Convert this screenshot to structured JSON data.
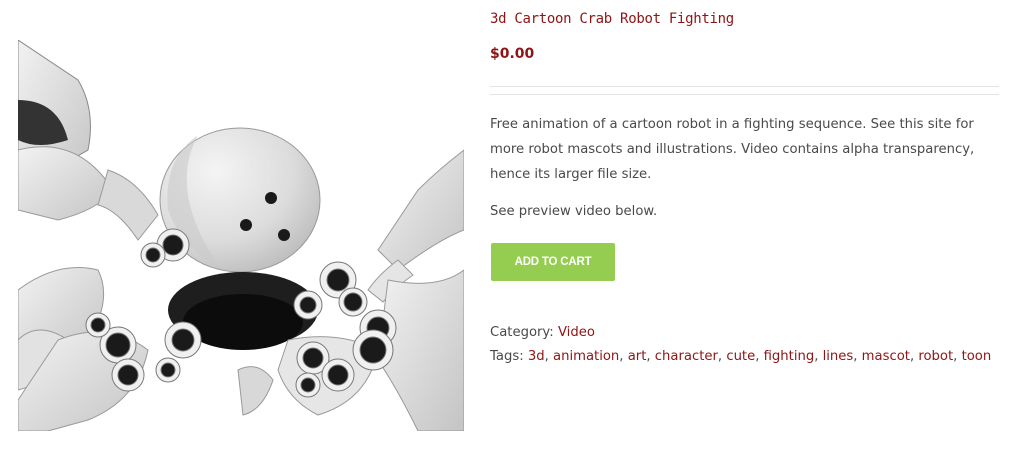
{
  "product": {
    "title": "3d Cartoon Crab Robot Fighting",
    "price": "$0.00",
    "description": "Free animation of a cartoon robot in a fighting sequence. See this site for more robot mascots and illustrations. Video contains alpha transparency, hence its larger file size.",
    "preview_note": "See preview video below.",
    "add_to_cart_label": "ADD TO CART",
    "category_label": "Category:",
    "category": "Video",
    "tags_label": "Tags:",
    "tags": [
      "3d",
      "animation",
      "art",
      "character",
      "cute",
      "fighting",
      "lines",
      "mascot",
      "robot",
      "toon"
    ]
  },
  "colors": {
    "accent": "#8e1515",
    "button": "#95cd50",
    "text": "#4a4a4a",
    "divider": "#e4e4e4"
  }
}
